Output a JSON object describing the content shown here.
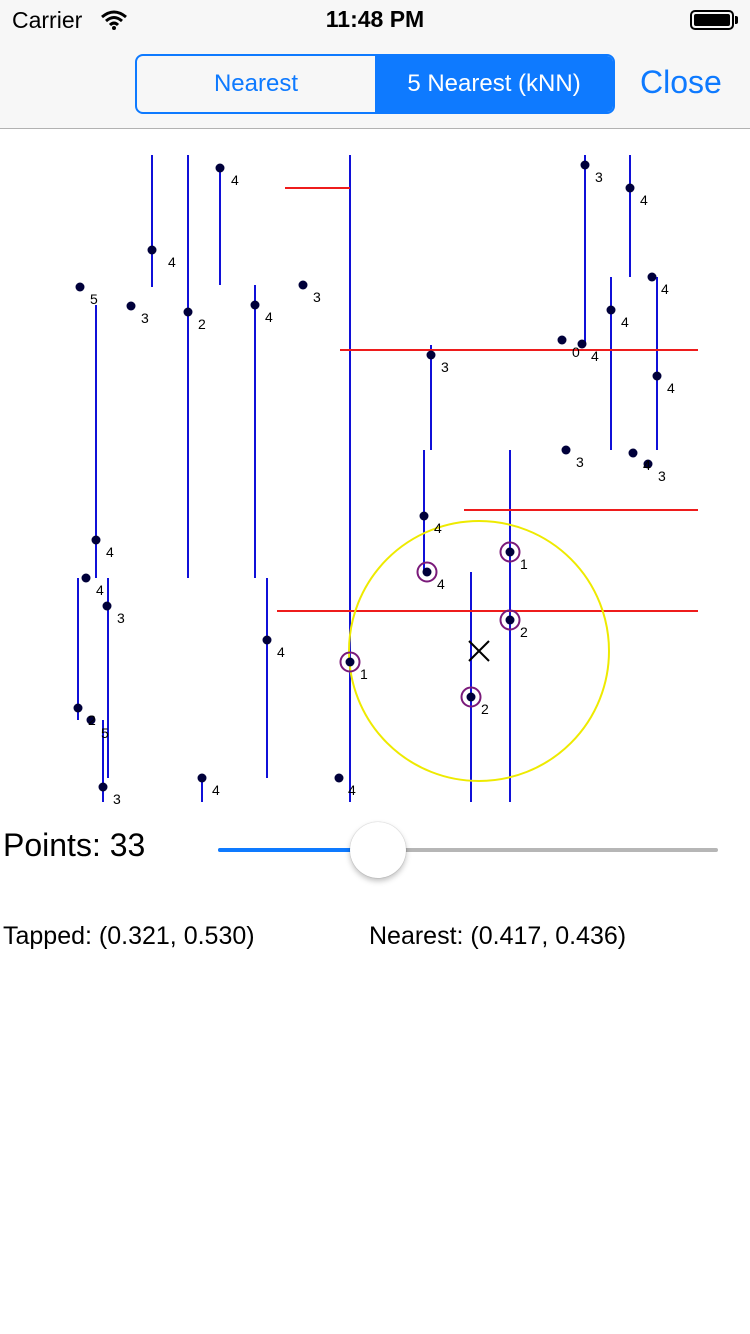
{
  "status_bar": {
    "carrier": "Carrier",
    "time": "11:48 PM"
  },
  "nav": {
    "segments": [
      "Nearest",
      "5 Nearest (kNN)"
    ],
    "selected_segment": 1,
    "close_label": "Close",
    "accent_color": "#0e7aff"
  },
  "canvas": {
    "labels": [
      "4",
      "4",
      "4",
      "5",
      "3",
      "2",
      "4",
      "3",
      "4",
      "4",
      "3",
      "2",
      "5",
      "3",
      "4",
      "4",
      "1",
      "3",
      "4",
      "4",
      "1",
      "2",
      "2",
      "3",
      "4",
      "4",
      "4",
      "0",
      "4",
      "4",
      "3",
      "4",
      "3"
    ]
  },
  "controls": {
    "points_label": "Points: 33",
    "slider_value": 0.32,
    "tapped_text": "Tapped: (0.321, 0.530)",
    "nearest_text": "Nearest: (0.417, 0.436)"
  }
}
